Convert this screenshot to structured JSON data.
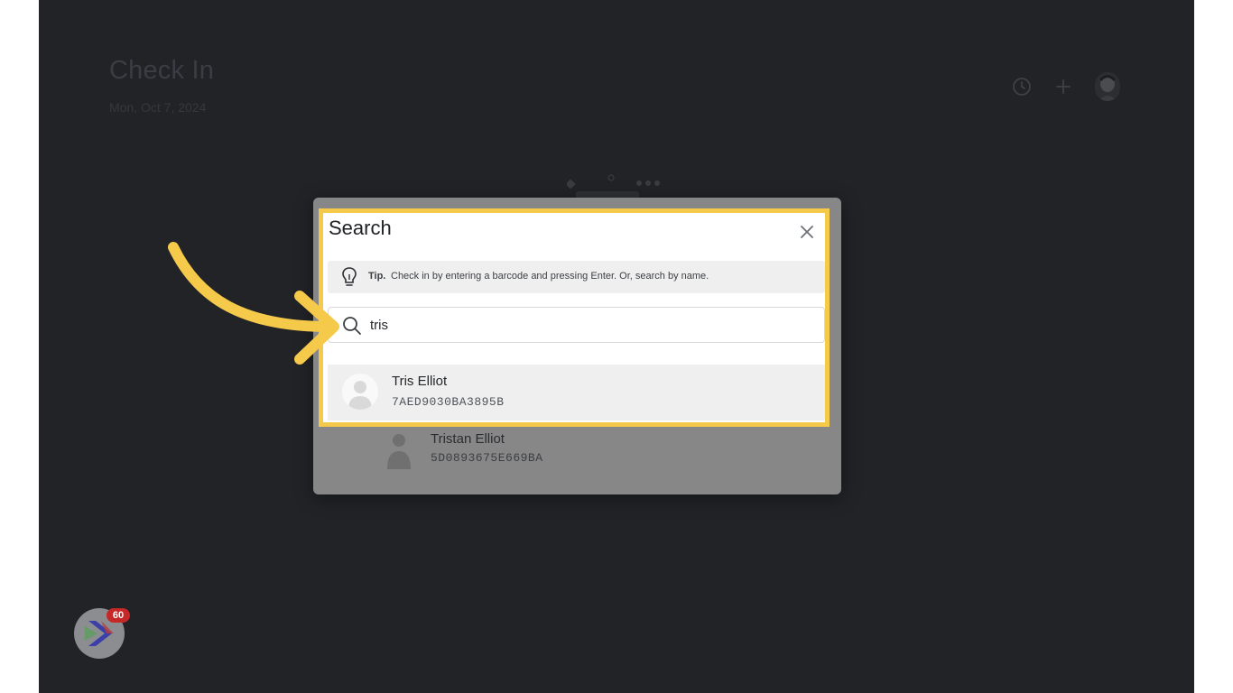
{
  "page": {
    "title": "Check In",
    "date": "Mon, Oct 7, 2024"
  },
  "header_icons": [
    "clock-icon",
    "plus-icon",
    "user-avatar"
  ],
  "modal": {
    "title": "Search",
    "tip_label": "Tip.",
    "tip_text": "Check in by entering a barcode and pressing Enter. Or, search by name.",
    "search_value": "tris",
    "results": [
      {
        "name": "Tris Elliot",
        "code": "7AED9030BA3895B"
      },
      {
        "name": "Tristan Elliot",
        "code": "5D0893675E669BA"
      }
    ]
  },
  "fab": {
    "badge": "60"
  },
  "colors": {
    "highlight": "#f5c94a",
    "backdrop": "#212327",
    "badge": "#c62828"
  }
}
